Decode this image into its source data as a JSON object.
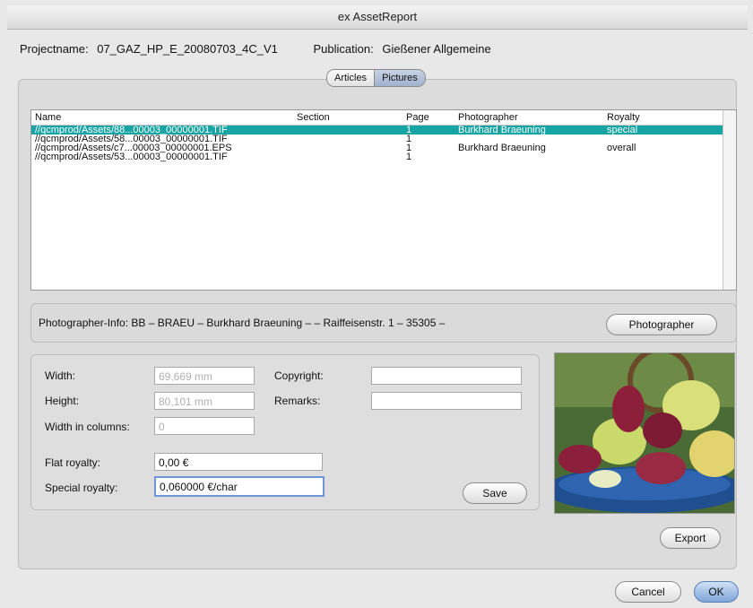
{
  "window": {
    "title": "ex AssetReport"
  },
  "header": {
    "project_label": "Projectname:",
    "project_value": "07_GAZ_HP_E_20080703_4C_V1",
    "publication_label": "Publication:",
    "publication_value": "Gießener Allgemeine"
  },
  "tabs": [
    {
      "label": "Articles"
    },
    {
      "label": "Pictures"
    }
  ],
  "table": {
    "columns": [
      "Name",
      "Section",
      "Page",
      "Photographer",
      "Royalty"
    ],
    "rows": [
      {
        "name": "//qcmprod/Assets/88...00003_00000001.TIF",
        "section": "",
        "page": "1",
        "photographer": "Burkhard Braeuning",
        "royalty": "special"
      },
      {
        "name": "//qcmprod/Assets/58...00003_00000001.TIF",
        "section": "",
        "page": "1",
        "photographer": "",
        "royalty": ""
      },
      {
        "name": "//qcmprod/Assets/c7...00003_00000001.EPS",
        "section": "",
        "page": "1",
        "photographer": "Burkhard Braeuning",
        "royalty": "overall"
      },
      {
        "name": "//qcmprod/Assets/53...00003_00000001.TIF",
        "section": "",
        "page": "1",
        "photographer": "",
        "royalty": ""
      }
    ]
  },
  "photographer_info": {
    "text": "Photographer-Info:  BB – BRAEU – Burkhard Braeuning –  – Raiffeisenstr. 1 – 35305 –",
    "button_label": "Photographer"
  },
  "form": {
    "width_label": "Width:",
    "width_value": "69,669 mm",
    "height_label": "Height:",
    "height_value": "80,101 mm",
    "columns_label": "Width in columns:",
    "columns_value": "0",
    "copyright_label": "Copyright:",
    "copyright_value": "",
    "remarks_label": "Remarks:",
    "remarks_value": "",
    "flat_royalty_label": "Flat royalty:",
    "flat_royalty_value": "0,00 €",
    "special_royalty_label": "Special royalty:",
    "special_royalty_value": "0,060000 €/char",
    "save_label": "Save"
  },
  "buttons": {
    "export": "Export",
    "cancel": "Cancel",
    "ok": "OK"
  },
  "colors": {
    "selection": "#16a4a4",
    "default_button": "#7fa5d8"
  }
}
